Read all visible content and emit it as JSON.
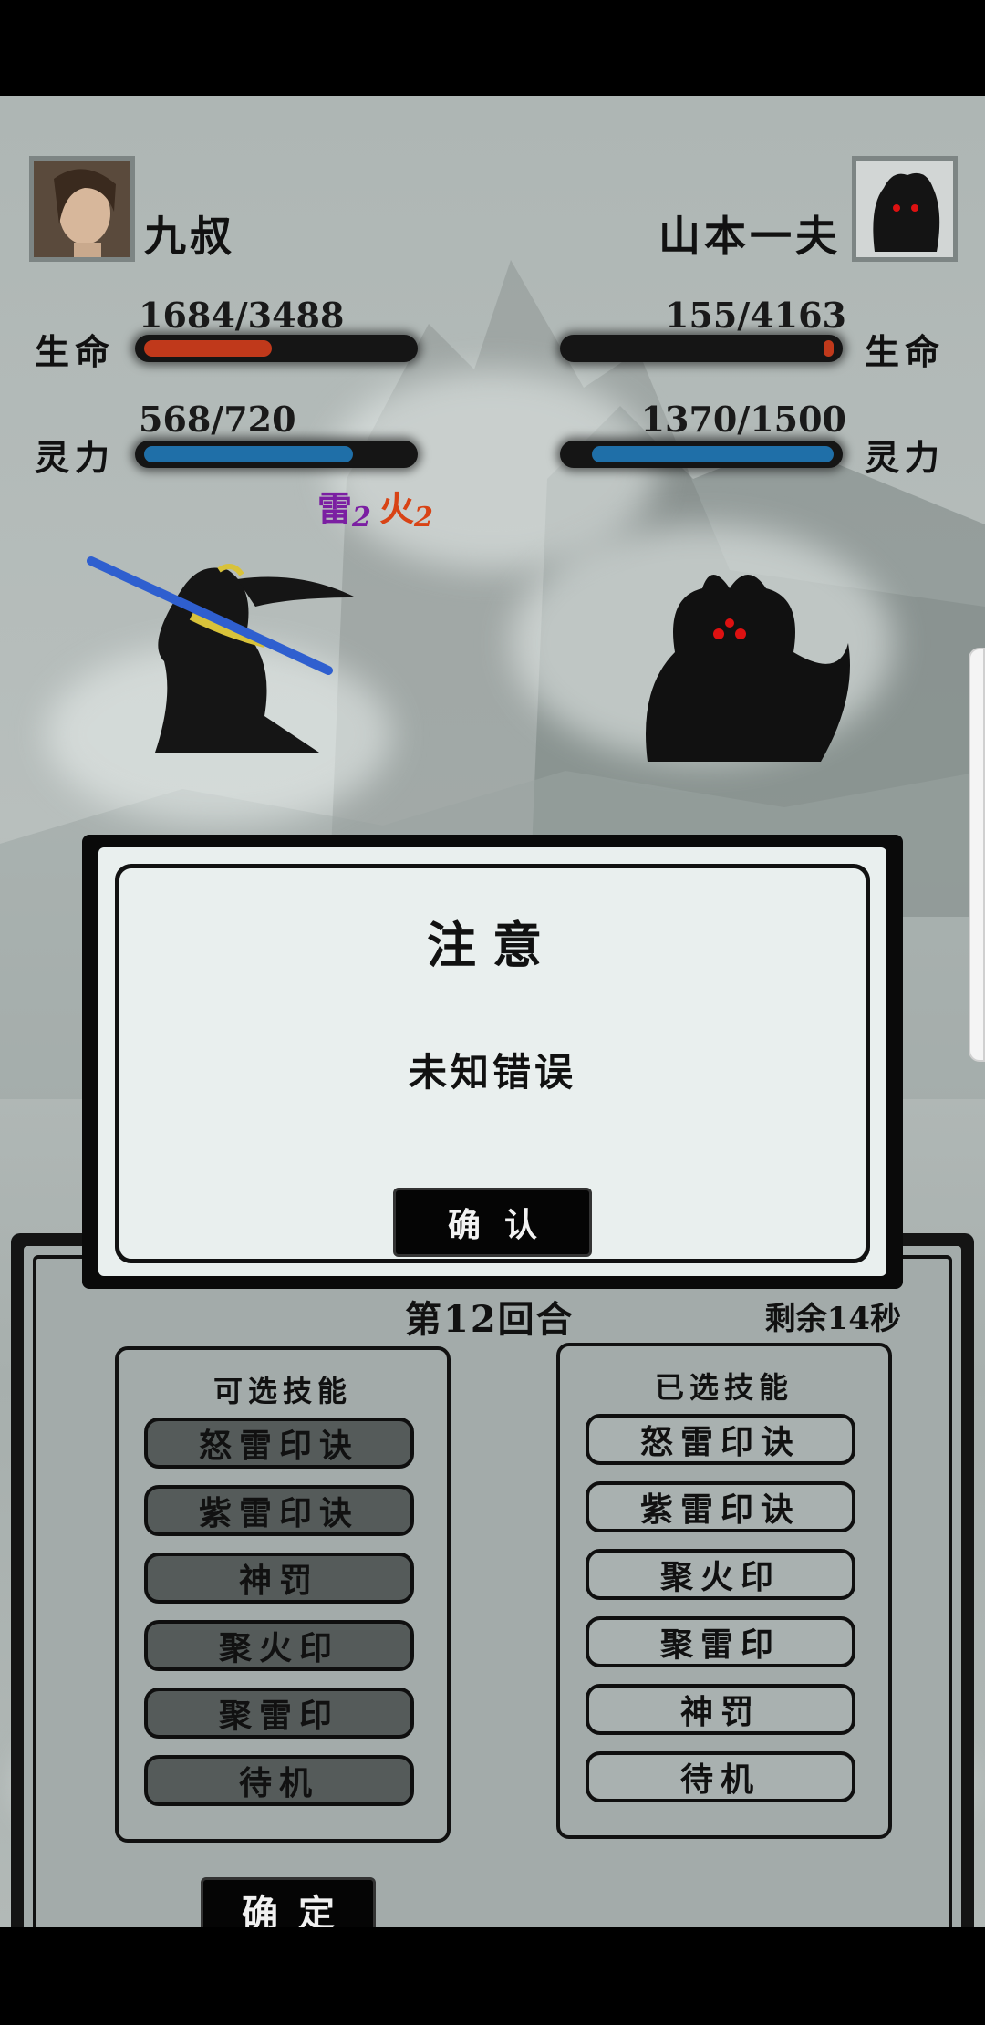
{
  "player": {
    "name": "九叔",
    "hp_label": "生命",
    "hp_text": "1684/3488",
    "hp_fraction": 0.483,
    "mp_label": "灵力",
    "mp_text": "568/720",
    "mp_fraction": 0.789,
    "status": [
      {
        "element": "雷",
        "count": "2",
        "color": "#7b1fa2"
      },
      {
        "element": "火",
        "count": "2",
        "color": "#d84315"
      }
    ]
  },
  "enemy": {
    "name": "山本一夫",
    "hp_label": "生命",
    "hp_text": "155/4163",
    "hp_fraction": 0.037,
    "mp_label": "灵力",
    "mp_text": "1370/1500",
    "mp_fraction": 0.913
  },
  "colors": {
    "hp_bar": "#c0391b",
    "mp_bar": "#1f6fa8"
  },
  "dialog": {
    "title": "注意",
    "message": "未知错误",
    "button_label": "确认"
  },
  "battle": {
    "round_text": "第12回合",
    "time_text": "剩余14秒",
    "available_title": "可选技能",
    "available_skills": [
      "怒雷印诀",
      "紫雷印诀",
      "神罚",
      "聚火印",
      "聚雷印",
      "待机"
    ],
    "selected_title": "已选技能",
    "selected_skills": [
      "怒雷印诀",
      "紫雷印诀",
      "聚火印",
      "聚雷印",
      "神罚",
      "待机"
    ],
    "confirm_label": "确定"
  },
  "icons": {
    "player_portrait": "taoist-portrait",
    "enemy_portrait": "demon-portrait"
  }
}
